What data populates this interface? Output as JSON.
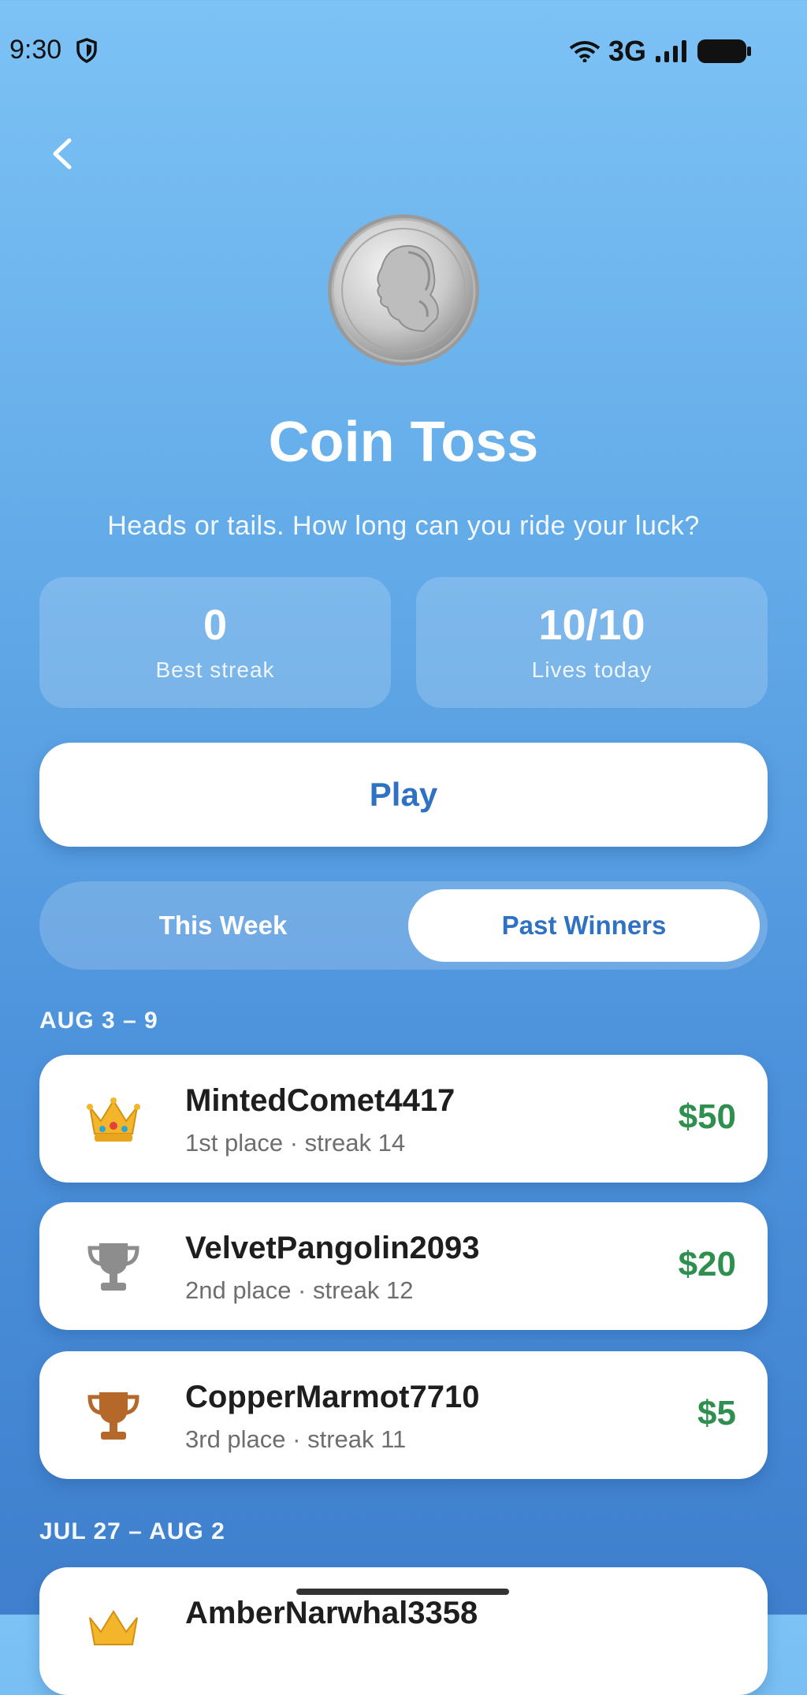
{
  "status_bar": {
    "time": "9:30",
    "network": "3G"
  },
  "game": {
    "title": "Coin Toss",
    "subtitle": "Heads or tails. How long can you ride your luck?"
  },
  "stats": [
    {
      "value": "0",
      "label": "Best streak"
    },
    {
      "value": "10/10",
      "label": "Lives today"
    }
  ],
  "play_label": "Play",
  "tabs": [
    {
      "label": "This Week",
      "selected": false
    },
    {
      "label": "Past Winners",
      "selected": true
    }
  ],
  "weeks": [
    {
      "range": "AUG 3 – 9",
      "winners": [
        {
          "name": "MintedComet4417",
          "detail": "1st place · streak 14",
          "prize": "$50",
          "icon": "crown-icon"
        },
        {
          "name": "VelvetPangolin2093",
          "detail": "2nd place · streak 12",
          "prize": "$20",
          "icon": "silver-trophy-icon"
        },
        {
          "name": "CopperMarmot7710",
          "detail": "3rd place · streak 11",
          "prize": "$5",
          "icon": "bronze-trophy-icon"
        }
      ]
    },
    {
      "range": "JUL 27 – AUG 2",
      "winners": [
        {
          "name": "AmberNarwhal3358",
          "icon": "crown-icon"
        }
      ]
    }
  ],
  "colors": {
    "accent": "#2f72c4",
    "prize": "#2f8f4e",
    "silver": "#8d8d8d",
    "bronze": "#b5682a",
    "crown": "#f3b62b"
  }
}
